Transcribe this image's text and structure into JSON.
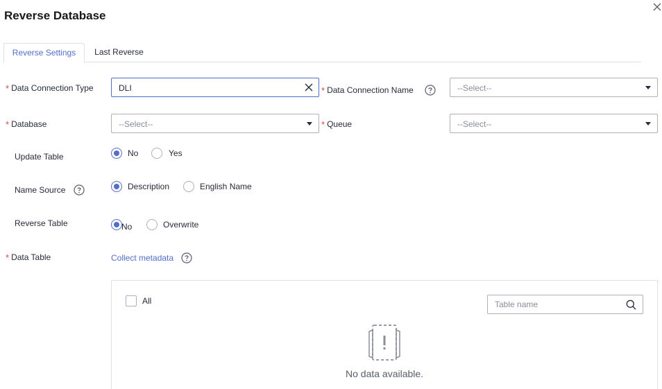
{
  "dialog": {
    "title": "Reverse Database"
  },
  "tabs": [
    {
      "label": "Reverse Settings",
      "active": true
    },
    {
      "label": "Last Reverse",
      "active": false
    }
  ],
  "form": {
    "data_connection_type": {
      "label": "Data Connection Type",
      "required": true,
      "value": "DLI"
    },
    "data_connection_name": {
      "label": "Data Connection Name",
      "required": true,
      "placeholder": "--Select--"
    },
    "database": {
      "label": "Database",
      "required": true,
      "placeholder": "--Select--"
    },
    "queue": {
      "label": "Queue",
      "required": true,
      "placeholder": "--Select--"
    },
    "update_table": {
      "label": "Update Table",
      "options": [
        {
          "label": "No",
          "checked": true
        },
        {
          "label": "Yes",
          "checked": false
        }
      ]
    },
    "name_source": {
      "label": "Name Source",
      "options": [
        {
          "label": "Description",
          "checked": true
        },
        {
          "label": "English Name",
          "checked": false
        }
      ]
    },
    "reverse_table": {
      "label": "Reverse Table",
      "options": [
        {
          "label": "No",
          "checked": true
        },
        {
          "label": "Overwrite",
          "checked": false
        }
      ]
    },
    "data_table": {
      "label": "Data Table",
      "required": true,
      "link": "Collect metadata"
    },
    "required_mark": "*"
  },
  "table_panel": {
    "select_all_label": "All",
    "search_placeholder": "Table name",
    "empty_text": "No data available."
  },
  "colors": {
    "accent": "#526ecc",
    "required": "#e54545",
    "border": "#adb0b8"
  }
}
